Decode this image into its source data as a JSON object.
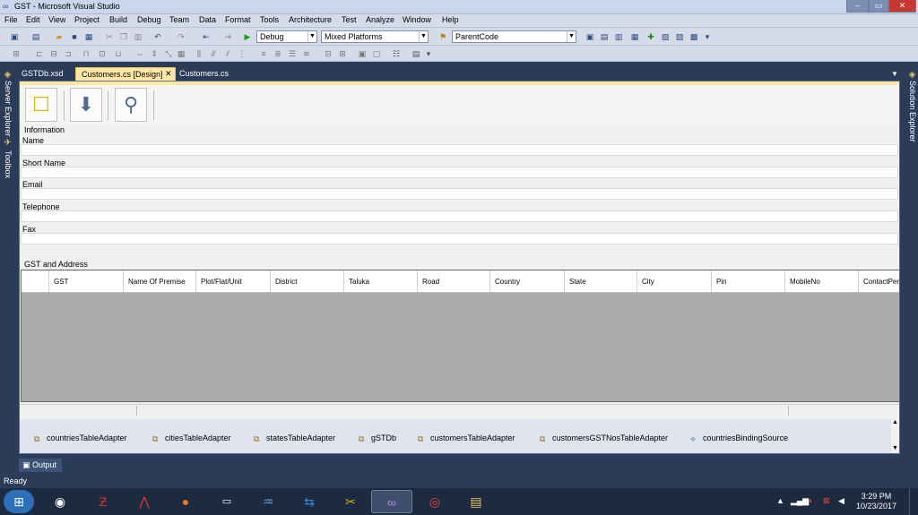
{
  "window": {
    "title": "GST - Microsoft Visual Studio",
    "minimize": "–",
    "maximize": "▭",
    "close": "✕"
  },
  "menu": [
    "File",
    "Edit",
    "View",
    "Project",
    "Build",
    "Debug",
    "Team",
    "Data",
    "Format",
    "Tools",
    "Architecture",
    "Test",
    "Analyze",
    "Window",
    "Help"
  ],
  "toolbar": {
    "config": "Debug",
    "platform": "Mixed Platforms",
    "target": "ParentCode"
  },
  "sidepanels": {
    "server_explorer": "Server Explorer",
    "toolbox": "Toolbox",
    "solution_explorer": "Solution Explorer"
  },
  "doc_tabs": [
    {
      "label": "GSTDb.xsd"
    },
    {
      "label": "Customers.cs [Design]"
    },
    {
      "label": "Customers.cs"
    }
  ],
  "form": {
    "information": "Information",
    "fields": [
      "Name",
      "Short Name",
      "Email",
      "Telephone",
      "Fax"
    ],
    "gst_group": "GST and Address",
    "columns": [
      "GST",
      "Name Of Premise",
      "Plot/Flat/Unit",
      "District",
      "Taluka",
      "Road",
      "Country",
      "State",
      "City",
      "Pin",
      "MobileNo",
      "ContactPers"
    ]
  },
  "components": [
    "countriesTableAdapter",
    "citiesTableAdapter",
    "statesTableAdapter",
    "gSTDb",
    "customersTableAdapter",
    "customersGSTNosTableAdapter",
    "countriesBindingSource"
  ],
  "output_tab": "Output",
  "status": "Ready",
  "clock": {
    "time": "3:29 PM",
    "date": "10/23/2017"
  },
  "colors": {
    "active_tab": "#ffe8a6",
    "frame": "#2b3c59"
  }
}
